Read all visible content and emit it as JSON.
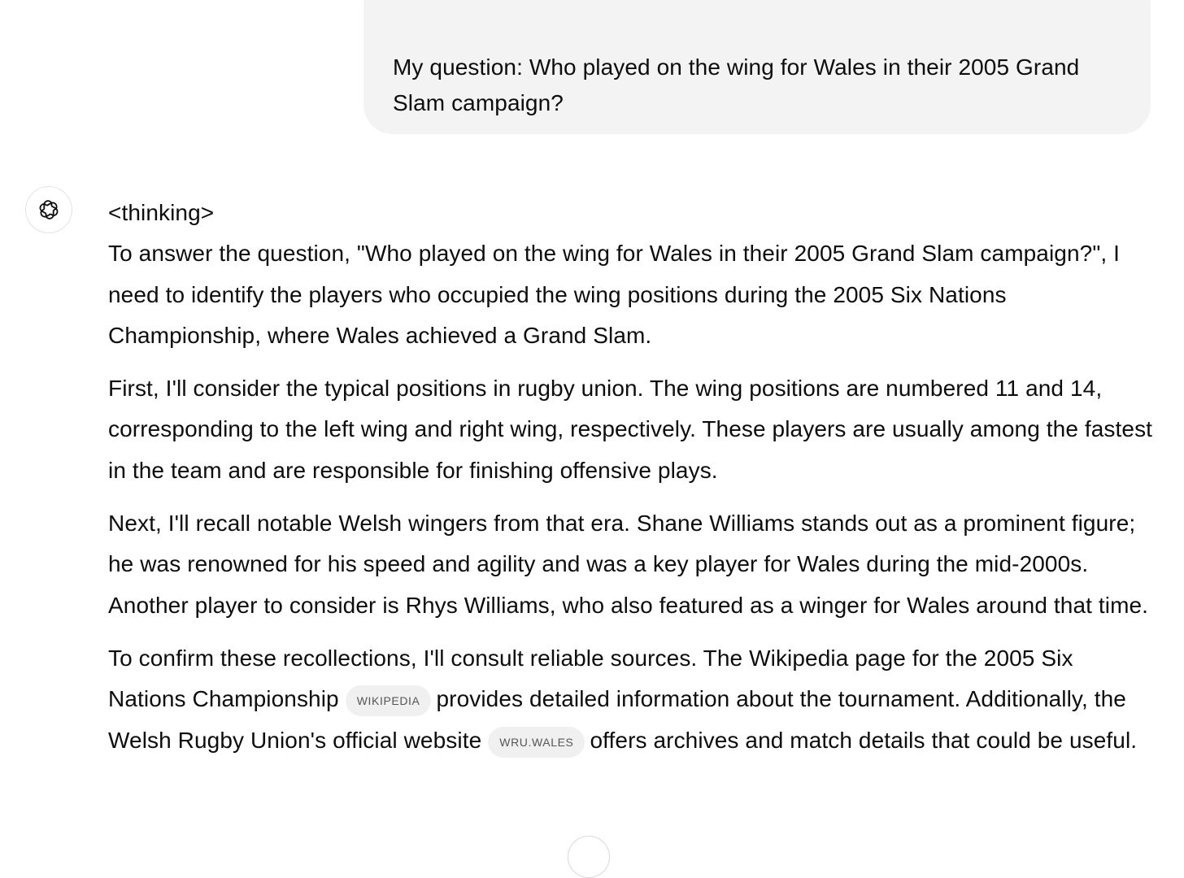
{
  "user_message": {
    "text": "My question:  Who played on the wing for Wales in their 2005 Grand Slam campaign?"
  },
  "assistant": {
    "avatar_icon": "openai-logo-icon",
    "thinking_tag": "<thinking>",
    "p1": "To answer the question, \"Who played on the wing for Wales in their 2005 Grand Slam campaign?\", I need to identify the players who occupied the wing positions during the 2005 Six Nations Championship, where Wales achieved a Grand Slam.",
    "p2": "First, I'll consider the typical positions in rugby union. The wing positions are numbered 11 and 14, corresponding to the left wing and right wing, respectively. These players are usually among the fastest in the team and are responsible for finishing offensive plays.",
    "p3": "Next, I'll recall notable Welsh wingers from that era. Shane Williams stands out as a prominent figure; he was renowned for his speed and agility and was a key player for Wales during the mid-2000s. Another player to consider is Rhys Williams, who also featured as a winger for Wales around that time.",
    "p4": {
      "part1": "To confirm these recollections, I'll consult reliable sources. The Wikipedia page for the 2005 Six Nations Championship",
      "chip1": "WIKIPEDIA",
      "part2": "provides detailed information about the tournament. Additionally, the Welsh Rugby Union's official website",
      "chip2": "WRU.WALES",
      "part3": "offers archives and match details that could be useful."
    }
  }
}
